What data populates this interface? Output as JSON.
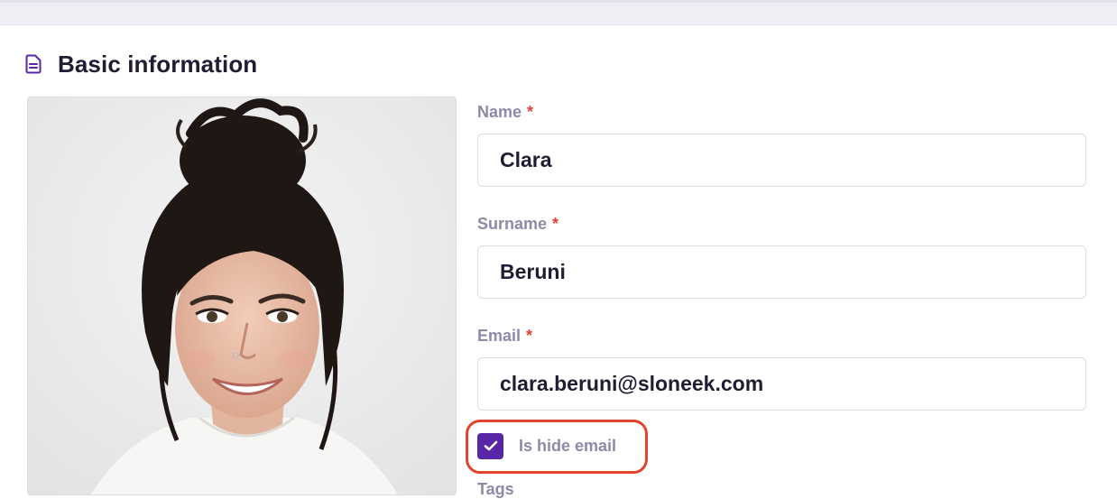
{
  "section": {
    "title": "Basic information",
    "icon": "document-icon",
    "accent": "#5727a7"
  },
  "form": {
    "name": {
      "label": "Name",
      "required": "*",
      "value": "Clara"
    },
    "surname": {
      "label": "Surname",
      "required": "*",
      "value": "Beruni"
    },
    "email": {
      "label": "Email",
      "required": "*",
      "value": "clara.beruni@sloneek.com"
    },
    "hide_email": {
      "label": "Is hide email",
      "checked": true
    },
    "tags": {
      "label": "Tags"
    }
  },
  "colors": {
    "label": "#8d8aa8",
    "required": "#e0433b",
    "checkbox": "#5727a7",
    "highlight": "#e2432f",
    "text": "#1f1d33"
  }
}
